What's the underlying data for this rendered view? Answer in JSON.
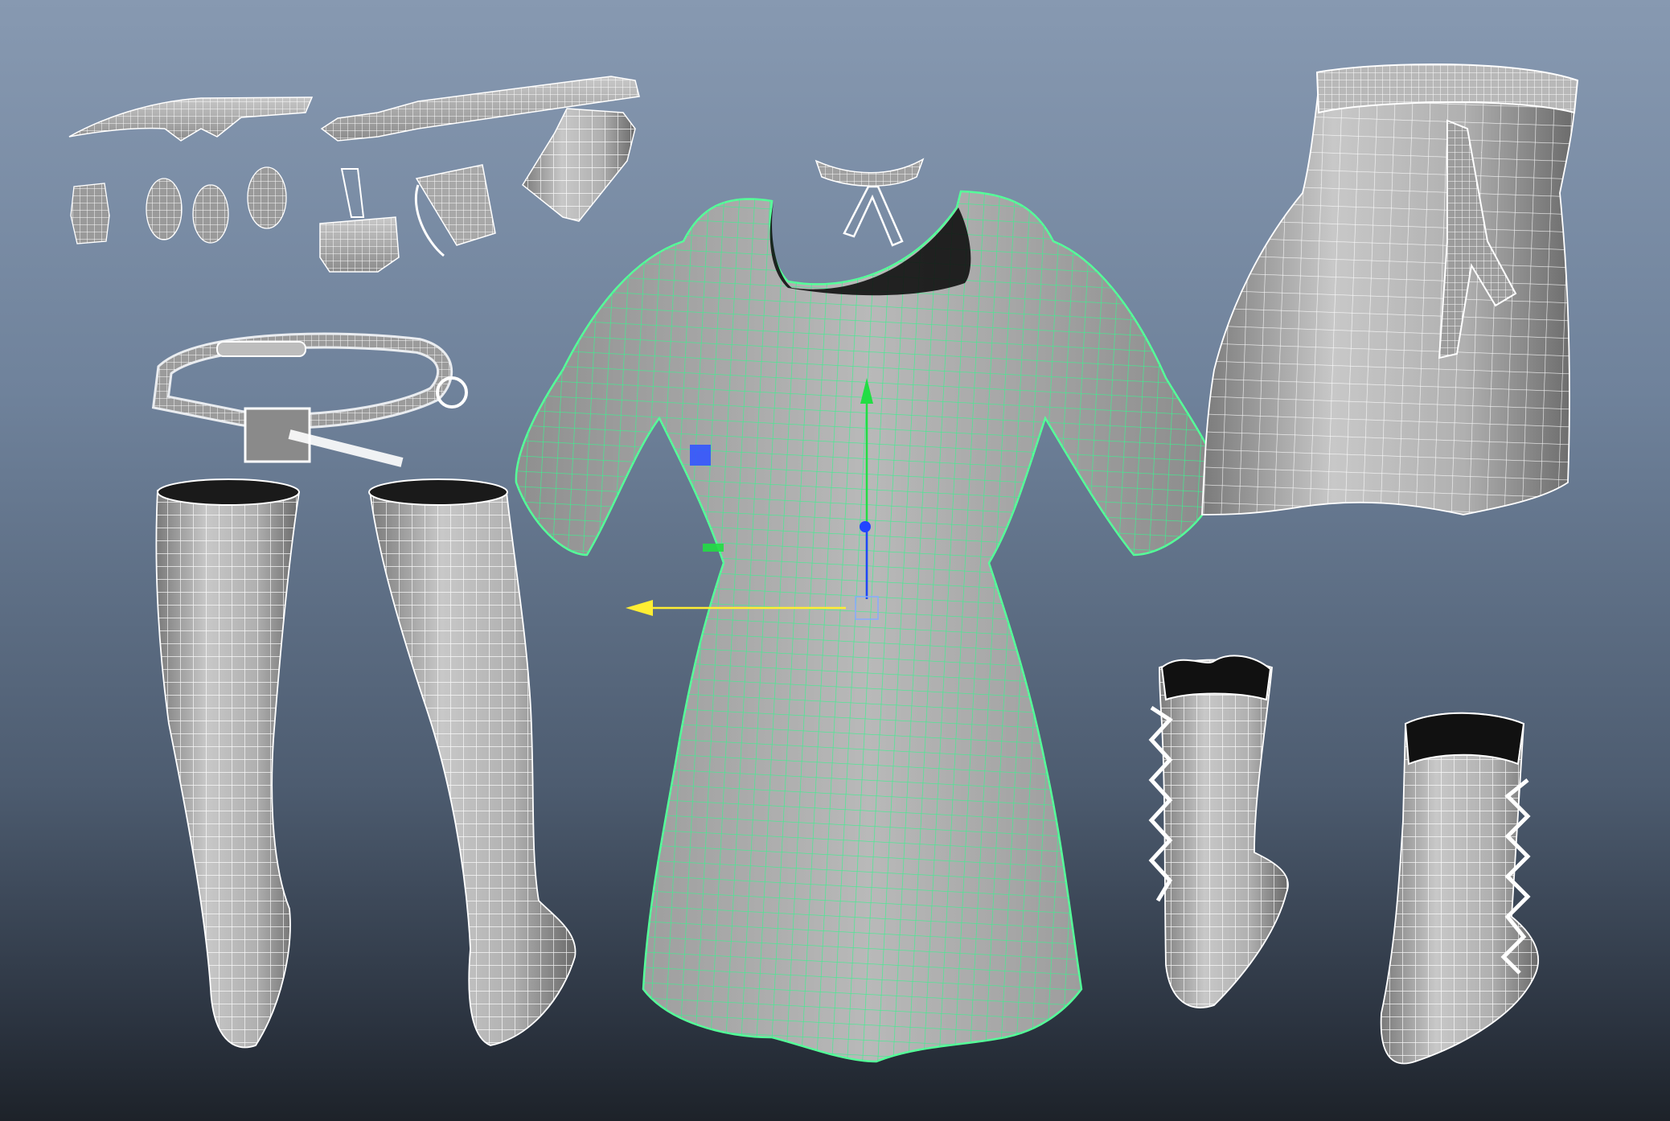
{
  "viewport": {
    "background_top": "#8799b1",
    "background_bottom": "#1d2229"
  },
  "colors": {
    "mesh_fill_light": "#d9d9d9",
    "mesh_fill_mid": "#a6a6a6",
    "mesh_fill_dark": "#5c5c5c",
    "wire_white": "#ffffff",
    "wire_selected": "#3cf08f",
    "selected_outline": "#55ff99",
    "gizmo_x": "#ffee33",
    "gizmo_y": "#22dd44",
    "gizmo_z": "#2244ff",
    "plane_xy": "#3355ff",
    "plane_xz": "#22dd44"
  },
  "scene": {
    "objects": [
      {
        "name": "knife",
        "selected": false
      },
      {
        "name": "bottle-flask",
        "selected": false
      },
      {
        "name": "pouch-small-1",
        "selected": false
      },
      {
        "name": "pouch-small-2",
        "selected": false
      },
      {
        "name": "pouch-small-3",
        "selected": false
      },
      {
        "name": "pouch-small-4",
        "selected": false
      },
      {
        "name": "hanging-bag",
        "selected": false
      },
      {
        "name": "strap-tag",
        "selected": false
      },
      {
        "name": "collar-bow",
        "selected": false
      },
      {
        "name": "belt",
        "selected": false
      },
      {
        "name": "dress",
        "selected": true
      },
      {
        "name": "apron-skirt",
        "selected": false
      },
      {
        "name": "stocking-left",
        "selected": false
      },
      {
        "name": "stocking-right",
        "selected": false
      },
      {
        "name": "boot-left",
        "selected": false
      },
      {
        "name": "boot-right",
        "selected": false
      }
    ]
  },
  "gizmo": {
    "type": "move-manipulator",
    "axes": [
      "x-axis-arrow",
      "y-axis-arrow",
      "z-axis-handle"
    ]
  }
}
